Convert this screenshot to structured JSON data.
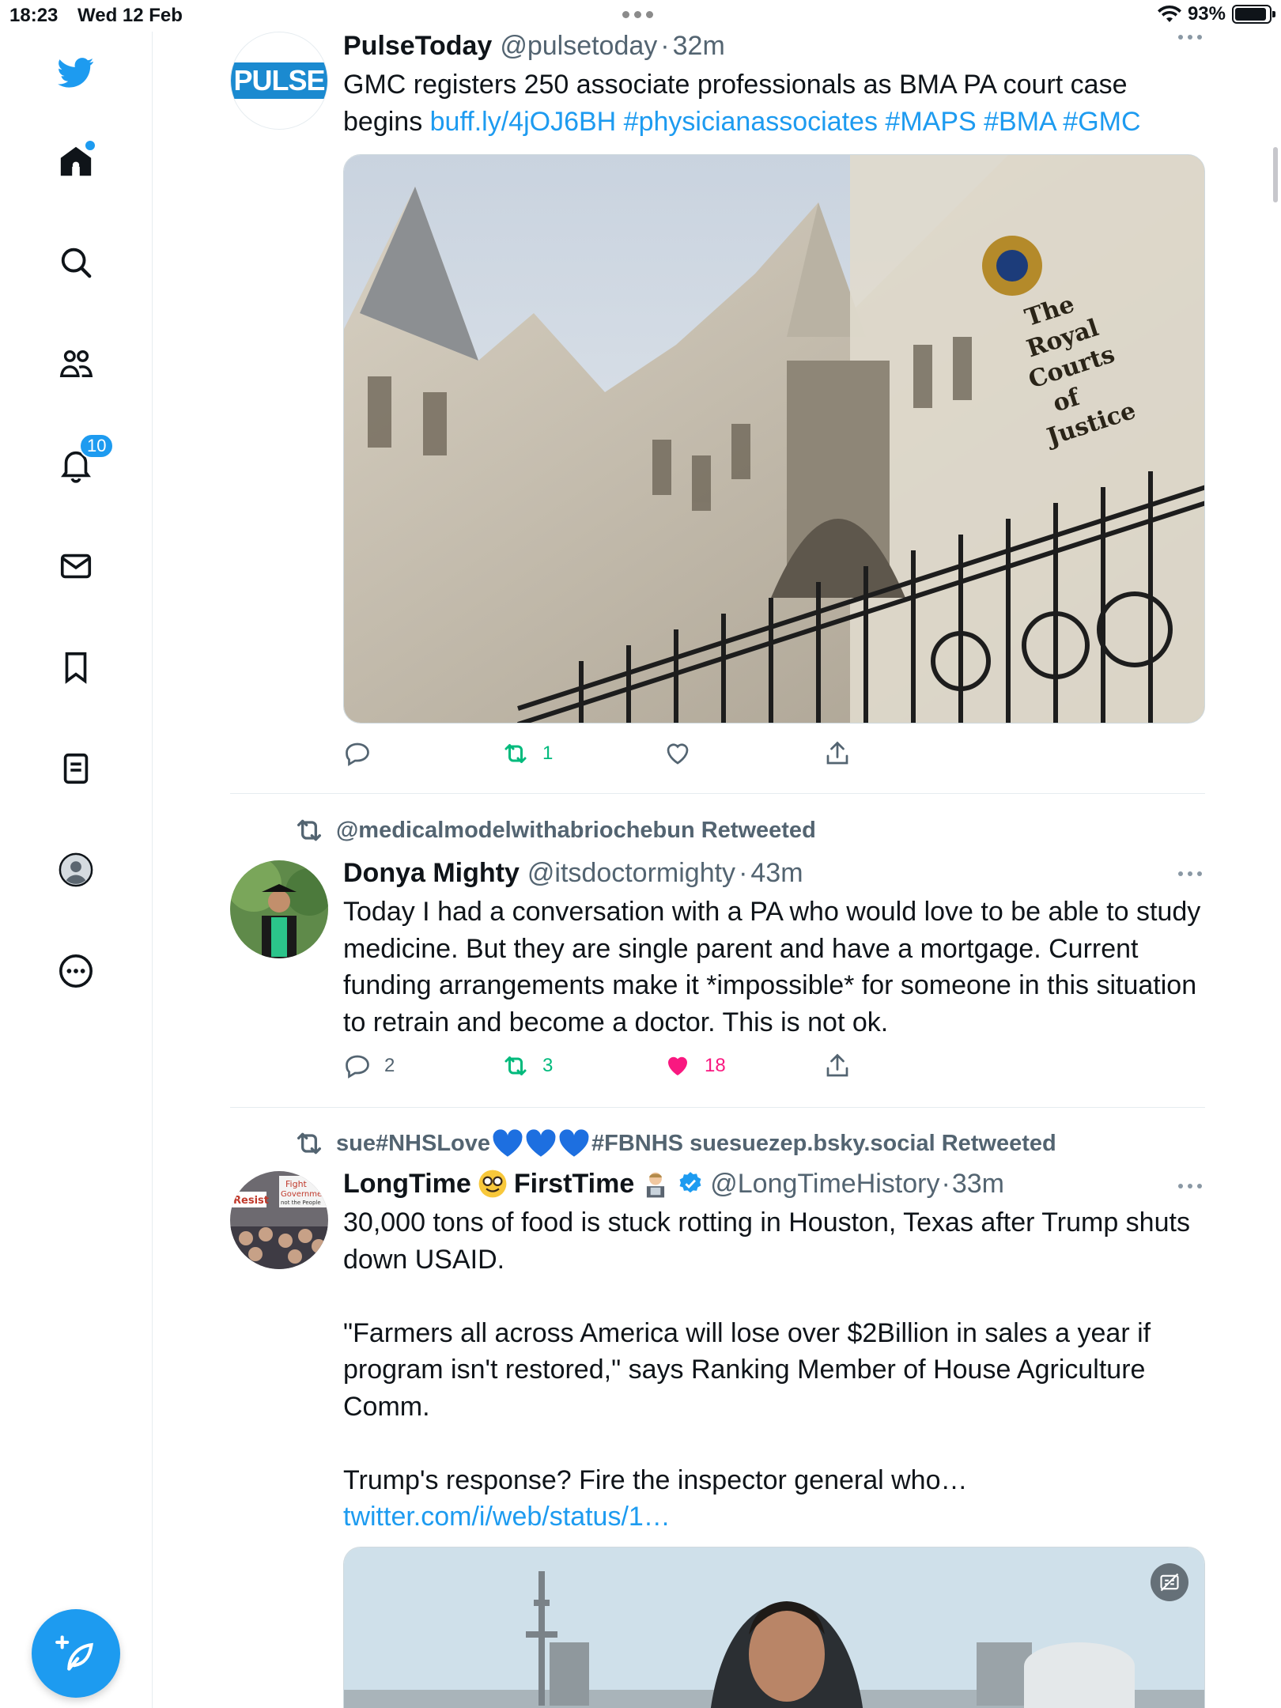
{
  "status": {
    "time": "18:23",
    "date": "Wed 12 Feb",
    "battery": "93%"
  },
  "sidebar": {
    "items": [
      {
        "name": "logo"
      },
      {
        "name": "home"
      },
      {
        "name": "explore"
      },
      {
        "name": "communities"
      },
      {
        "name": "notifications",
        "badge": "10"
      },
      {
        "name": "messages"
      },
      {
        "name": "bookmarks"
      },
      {
        "name": "lists"
      },
      {
        "name": "profile"
      },
      {
        "name": "more"
      }
    ]
  },
  "tweets": [
    {
      "name": "PulseToday",
      "handle": "@pulsetoday",
      "sep": "·",
      "time": "32m",
      "avatar_text": "PULSE",
      "text": "GMC registers 250 associate professionals as BMA PA court case begins ",
      "links": "buff.ly/4jOJ6BH #physicianassociates #MAPS #BMA #GMC",
      "media_caption": [
        "The",
        "Royal",
        "Courts",
        "of",
        "Justice"
      ],
      "replies": "",
      "retweets": "1",
      "likes": ""
    },
    {
      "context": "@medicalmodelwithabriochebun Retweeted",
      "name": "Donya Mighty",
      "handle": "@itsdoctormighty",
      "sep": "·",
      "time": "43m",
      "text": "Today I had a conversation with a PA who would love to be able to study medicine. But they are single parent and have a mortgage. Current funding arrangements make it *impossible* for someone in this situation to retrain and become a doctor. This is not ok.",
      "replies": "2",
      "retweets": "3",
      "likes": "18"
    },
    {
      "context_a": "sue#NHSLove",
      "context_b": "#FBNHS suesuezep.bsky.social Retweeted",
      "name_a": "LongTime",
      "name_b": "FirstTime",
      "handle": "@LongTimeHistory",
      "sep": "·",
      "time": "33m",
      "avatar_words": [
        "Resist",
        "Fight",
        "Governme",
        "not the People"
      ],
      "text": "30,000 tons of food is stuck rotting in Houston, Texas after Trump shuts down USAID.\n\n\"Farmers all across America will lose over $2Billion in sales a year if program isn't restored,\" says Ranking Member of House Agriculture Comm.\n\nTrump's response? Fire the inspector general who… ",
      "link": "twitter.com/i/web/status/1…"
    }
  ],
  "colors": {
    "accent": "#1d9bf0",
    "retweet": "#00ba7c",
    "like": "#f91880",
    "muted": "#536471"
  }
}
